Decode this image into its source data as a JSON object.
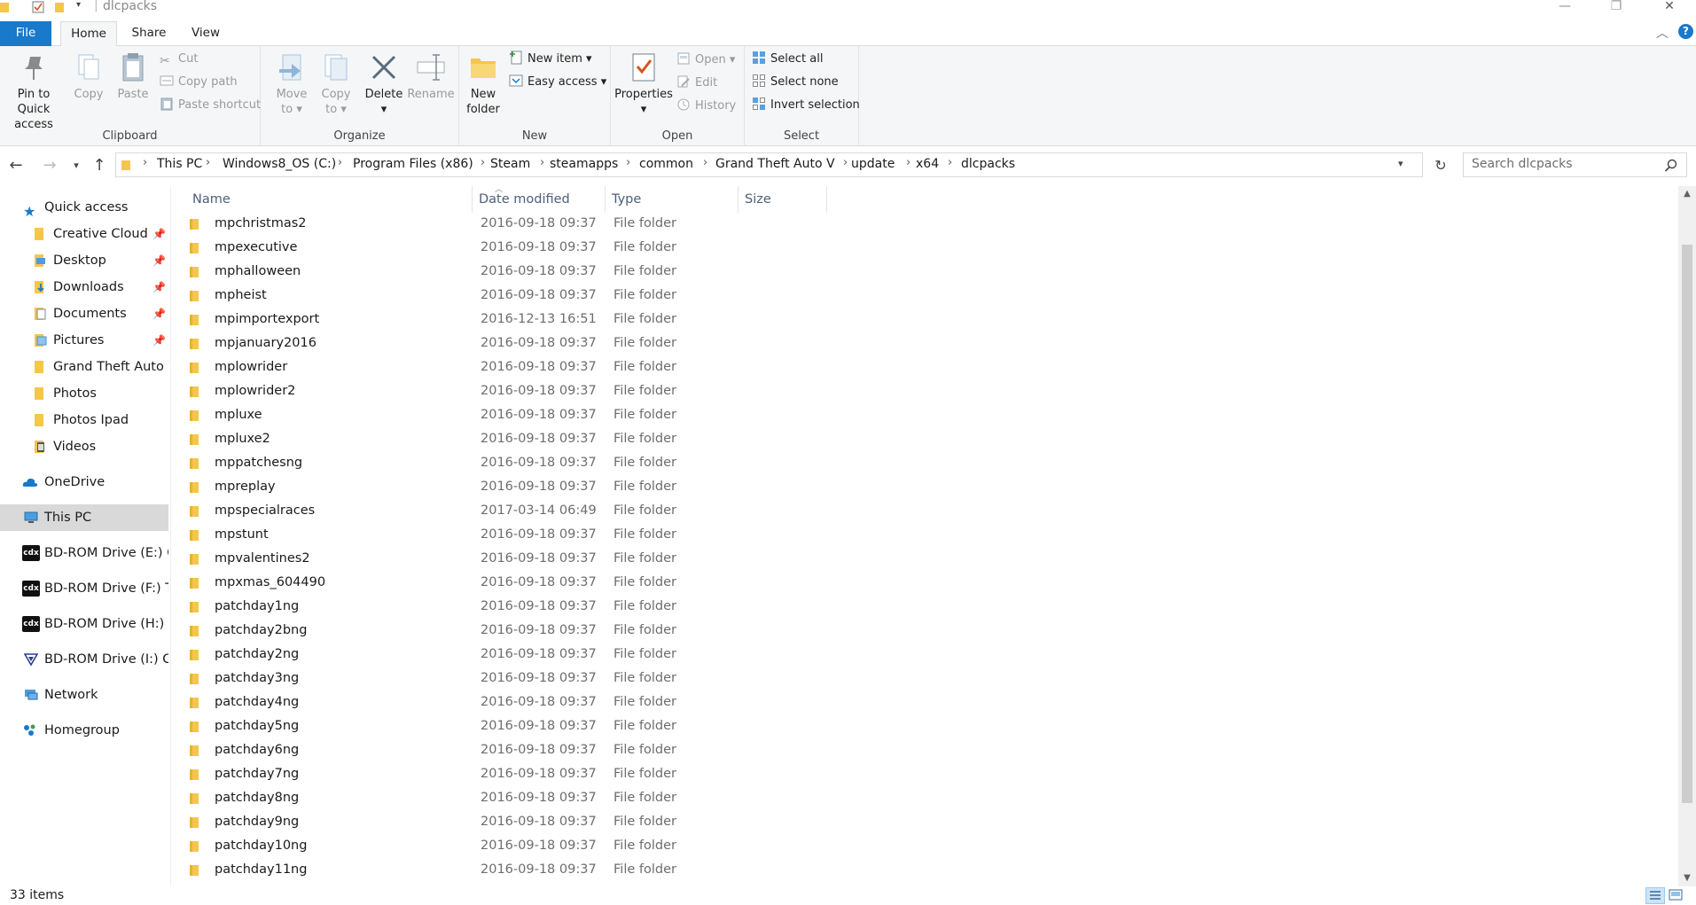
{
  "window": {
    "title": "dlcpacks",
    "minimize": "—",
    "restore": "❐",
    "close": "✕"
  },
  "ribbon": {
    "tabs": [
      "File",
      "Home",
      "Share",
      "View"
    ],
    "clipboard": {
      "label": "Clipboard",
      "pin": "Pin to Quick access",
      "pin_l1": "Pin to Quick",
      "pin_l2": "access",
      "copy": "Copy",
      "paste": "Paste",
      "cut": "Cut",
      "copy_path": "Copy path",
      "paste_shortcut": "Paste shortcut"
    },
    "organize": {
      "label": "Organize",
      "move_l1": "Move",
      "move_l2": "to",
      "copy_l1": "Copy",
      "copy_l2": "to",
      "delete": "Delete",
      "rename": "Rename"
    },
    "new": {
      "label": "New",
      "new_folder_l1": "New",
      "new_folder_l2": "folder",
      "new_item": "New item",
      "easy_access": "Easy access"
    },
    "open": {
      "label": "Open",
      "properties": "Properties",
      "open": "Open",
      "edit": "Edit",
      "history": "History"
    },
    "select": {
      "label": "Select",
      "select_all": "Select all",
      "select_none": "Select none",
      "invert": "Invert selection"
    }
  },
  "address": {
    "crumbs": [
      "This PC",
      "Windows8_OS (C:)",
      "Program Files (x86)",
      "Steam",
      "steamapps",
      "common",
      "Grand Theft Auto V",
      "update",
      "x64",
      "dlcpacks"
    ],
    "search_placeholder": "Search dlcpacks"
  },
  "navpane": {
    "quick_access": "Quick access",
    "items": [
      {
        "label": "Creative Cloud Fi",
        "pinned": true
      },
      {
        "label": "Desktop",
        "pinned": true
      },
      {
        "label": "Downloads",
        "pinned": true
      },
      {
        "label": "Documents",
        "pinned": true
      },
      {
        "label": "Pictures",
        "pinned": true
      },
      {
        "label": "Grand Theft Auto V",
        "pinned": false
      },
      {
        "label": "Photos",
        "pinned": false
      },
      {
        "label": "Photos Ipad",
        "pinned": false
      },
      {
        "label": "Videos",
        "pinned": false
      }
    ],
    "onedrive": "OneDrive",
    "this_pc": "This PC",
    "drives": [
      "BD-ROM Drive (E:) Ci",
      "BD-ROM Drive (F:) To",
      "BD-ROM Drive (H:) N",
      "BD-ROM Drive (I:) Ca"
    ],
    "network": "Network",
    "homegroup": "Homegroup"
  },
  "filelist": {
    "columns": {
      "name": "Name",
      "date": "Date modified",
      "type": "Type",
      "size": "Size"
    },
    "rows": [
      {
        "name": "mpchristmas2",
        "date": "2016-09-18 09:37",
        "type": "File folder"
      },
      {
        "name": "mpexecutive",
        "date": "2016-09-18 09:37",
        "type": "File folder"
      },
      {
        "name": "mphalloween",
        "date": "2016-09-18 09:37",
        "type": "File folder"
      },
      {
        "name": "mpheist",
        "date": "2016-09-18 09:37",
        "type": "File folder"
      },
      {
        "name": "mpimportexport",
        "date": "2016-12-13 16:51",
        "type": "File folder"
      },
      {
        "name": "mpjanuary2016",
        "date": "2016-09-18 09:37",
        "type": "File folder"
      },
      {
        "name": "mplowrider",
        "date": "2016-09-18 09:37",
        "type": "File folder"
      },
      {
        "name": "mplowrider2",
        "date": "2016-09-18 09:37",
        "type": "File folder"
      },
      {
        "name": "mpluxe",
        "date": "2016-09-18 09:37",
        "type": "File folder"
      },
      {
        "name": "mpluxe2",
        "date": "2016-09-18 09:37",
        "type": "File folder"
      },
      {
        "name": "mppatchesng",
        "date": "2016-09-18 09:37",
        "type": "File folder"
      },
      {
        "name": "mpreplay",
        "date": "2016-09-18 09:37",
        "type": "File folder"
      },
      {
        "name": "mpspecialraces",
        "date": "2017-03-14 06:49",
        "type": "File folder"
      },
      {
        "name": "mpstunt",
        "date": "2016-09-18 09:37",
        "type": "File folder"
      },
      {
        "name": "mpvalentines2",
        "date": "2016-09-18 09:37",
        "type": "File folder"
      },
      {
        "name": "mpxmas_604490",
        "date": "2016-09-18 09:37",
        "type": "File folder"
      },
      {
        "name": "patchday1ng",
        "date": "2016-09-18 09:37",
        "type": "File folder"
      },
      {
        "name": "patchday2bng",
        "date": "2016-09-18 09:37",
        "type": "File folder"
      },
      {
        "name": "patchday2ng",
        "date": "2016-09-18 09:37",
        "type": "File folder"
      },
      {
        "name": "patchday3ng",
        "date": "2016-09-18 09:37",
        "type": "File folder"
      },
      {
        "name": "patchday4ng",
        "date": "2016-09-18 09:37",
        "type": "File folder"
      },
      {
        "name": "patchday5ng",
        "date": "2016-09-18 09:37",
        "type": "File folder"
      },
      {
        "name": "patchday6ng",
        "date": "2016-09-18 09:37",
        "type": "File folder"
      },
      {
        "name": "patchday7ng",
        "date": "2016-09-18 09:37",
        "type": "File folder"
      },
      {
        "name": "patchday8ng",
        "date": "2016-09-18 09:37",
        "type": "File folder"
      },
      {
        "name": "patchday9ng",
        "date": "2016-09-18 09:37",
        "type": "File folder"
      },
      {
        "name": "patchday10ng",
        "date": "2016-09-18 09:37",
        "type": "File folder"
      },
      {
        "name": "patchday11ng",
        "date": "2016-09-18 09:37",
        "type": "File folder"
      }
    ]
  },
  "status": {
    "item_count": "33 items"
  },
  "colors": {
    "accent": "#1979ca",
    "folder": "#f4c64a",
    "header_text": "#4c607a"
  }
}
